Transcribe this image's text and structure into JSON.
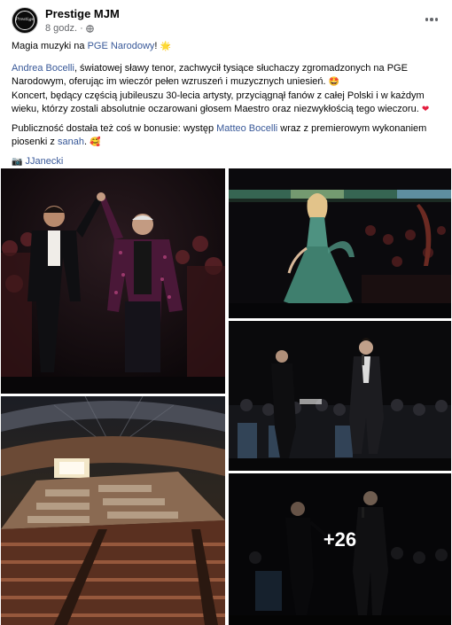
{
  "header": {
    "page_name": "Prestige MJM",
    "avatar_text": "Prestige",
    "time": "8 godz.",
    "separator": "·",
    "globe_icon": "globe-icon",
    "more_icon": "more-horizontal-icon"
  },
  "post": {
    "line1_text": "Magia muzyki na ",
    "line1_link": "PGE Narodowy",
    "line1_tail": "!",
    "line1_emoji": "🌟",
    "p2_link": "Andrea Bocelli",
    "p2_text": ", światowej sławy tenor, zachwycił tysiące słuchaczy zgromadzonych na PGE Narodowym, oferując im wieczór pełen wzruszeń i muzycznych uniesień.",
    "p2_emoji": "🤩",
    "p3_text": "Koncert, będący częścią jubileuszu 30-lecia artysty, przyciągnął fanów z całej Polski i w każdym wieku, którzy zostali absolutnie oczarowani głosem Maestro oraz niezwykłością tego wieczoru.",
    "p3_emoji": "❤",
    "p4_text": "Publiczność dostała też coś w bonusie: występ ",
    "p4_link1": "Matteo Bocelli",
    "p4_mid": " wraz z premierowym wykonaniem piosenki z ",
    "p4_link2": "sanah",
    "p4_tail": ".",
    "p4_emoji": "🥰",
    "credit_icon": "camera-icon",
    "credit_glyph": "📷",
    "credit_link": "JJanecki"
  },
  "colors": {
    "link": "#385898",
    "meta_text": "#65676b",
    "stage_light": "#f3e7c8",
    "gown": "#3f7f6e",
    "suit_pattern": "#a0306a"
  },
  "photos": {
    "more_count": "+26",
    "items": [
      {
        "name": "photo-bocelli-duo-bow"
      },
      {
        "name": "photo-singer-green-gown"
      },
      {
        "name": "photo-matteo-orchestra"
      },
      {
        "name": "photo-stadium-audience"
      },
      {
        "name": "photo-matteo-conductor"
      }
    ]
  }
}
